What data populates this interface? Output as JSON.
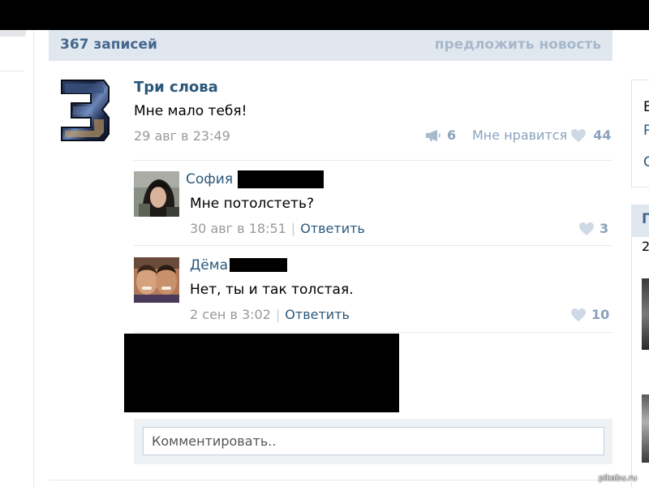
{
  "wall": {
    "count_label": "367 записей",
    "suggest_label": "предложить новость"
  },
  "post": {
    "author": "Три слова",
    "text": "Мне мало тебя!",
    "date": "29 авг в 23:49",
    "shares": "6",
    "like_label": "Мне нравится",
    "likes": "44"
  },
  "comments": [
    {
      "author": "София",
      "text": "Мне потолстеть?",
      "date": "30 авг в 18:51",
      "reply_label": "Ответить",
      "likes": "3"
    },
    {
      "author": "Дёма",
      "text": "Нет, ты и так толстая.",
      "date": "2 сен в 3:02",
      "reply_label": "Ответить",
      "likes": "10"
    }
  ],
  "comment_input": {
    "placeholder": "Комментировать.."
  },
  "right_sidebar": {
    "card1_lines": [
      "Е",
      "Р",
      "С"
    ],
    "card2_title": "П",
    "card2_sub": "2"
  },
  "watermark": "pikabu.ru",
  "colors": {
    "link": "#2b587a",
    "header_bg": "#e1e7ee",
    "muted_blue": "#8aa2bd",
    "gray_text": "#999999"
  },
  "icons": {
    "share": "megaphone-icon",
    "like": "heart-icon"
  }
}
